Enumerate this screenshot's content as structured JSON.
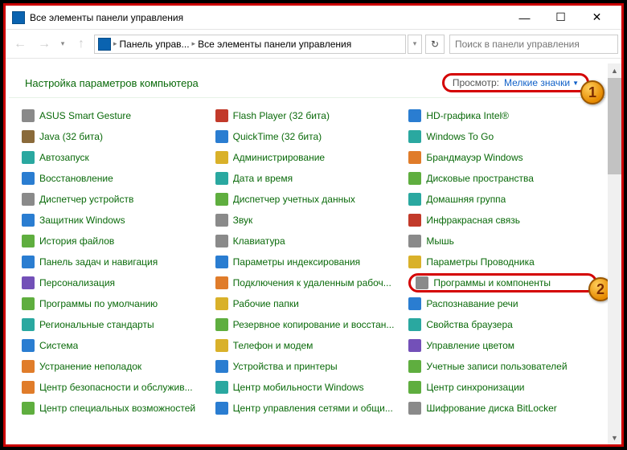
{
  "window": {
    "title": "Все элементы панели управления"
  },
  "breadcrumb": {
    "root": "Панель управ...",
    "current": "Все элементы панели управления"
  },
  "search": {
    "placeholder": "Поиск в панели управления"
  },
  "header": {
    "title": "Настройка параметров компьютера",
    "view_label": "Просмотр:",
    "view_value": "Мелкие значки"
  },
  "items": {
    "col1": [
      {
        "label": "ASUS Smart Gesture",
        "cls": "c-gray"
      },
      {
        "label": "Java (32 бита)",
        "cls": "c-brown"
      },
      {
        "label": "Автозапуск",
        "cls": "c-teal"
      },
      {
        "label": "Восстановление",
        "cls": "c-blue"
      },
      {
        "label": "Диспетчер устройств",
        "cls": "c-gray"
      },
      {
        "label": "Защитник Windows",
        "cls": "c-blue"
      },
      {
        "label": "История файлов",
        "cls": "c-green"
      },
      {
        "label": "Панель задач и навигация",
        "cls": "c-blue"
      },
      {
        "label": "Персонализация",
        "cls": "c-purple"
      },
      {
        "label": "Программы по умолчанию",
        "cls": "c-green"
      },
      {
        "label": "Региональные стандарты",
        "cls": "c-teal"
      },
      {
        "label": "Система",
        "cls": "c-blue"
      },
      {
        "label": "Устранение неполадок",
        "cls": "c-orange"
      },
      {
        "label": "Центр безопасности и обслужив...",
        "cls": "c-orange"
      },
      {
        "label": "Центр специальных возможностей",
        "cls": "c-green"
      }
    ],
    "col2": [
      {
        "label": "Flash Player (32 бита)",
        "cls": "c-red"
      },
      {
        "label": "QuickTime (32 бита)",
        "cls": "c-blue"
      },
      {
        "label": "Администрирование",
        "cls": "c-yellow"
      },
      {
        "label": "Дата и время",
        "cls": "c-teal"
      },
      {
        "label": "Диспетчер учетных данных",
        "cls": "c-green"
      },
      {
        "label": "Звук",
        "cls": "c-gray"
      },
      {
        "label": "Клавиатура",
        "cls": "c-gray"
      },
      {
        "label": "Параметры индексирования",
        "cls": "c-blue"
      },
      {
        "label": "Подключения к удаленным рабоч...",
        "cls": "c-orange"
      },
      {
        "label": "Рабочие папки",
        "cls": "c-yellow"
      },
      {
        "label": "Резервное копирование и восстан...",
        "cls": "c-green"
      },
      {
        "label": "Телефон и модем",
        "cls": "c-yellow"
      },
      {
        "label": "Устройства и принтеры",
        "cls": "c-blue"
      },
      {
        "label": "Центр мобильности Windows",
        "cls": "c-teal"
      },
      {
        "label": "Центр управления сетями и общи...",
        "cls": "c-blue"
      }
    ],
    "col3": [
      {
        "label": "HD-графика Intel®",
        "cls": "c-blue"
      },
      {
        "label": "Windows To Go",
        "cls": "c-teal"
      },
      {
        "label": "Брандмауэр Windows",
        "cls": "c-orange"
      },
      {
        "label": "Дисковые пространства",
        "cls": "c-green"
      },
      {
        "label": "Домашняя группа",
        "cls": "c-teal"
      },
      {
        "label": "Инфракрасная связь",
        "cls": "c-red"
      },
      {
        "label": "Мышь",
        "cls": "c-gray"
      },
      {
        "label": "Параметры Проводника",
        "cls": "c-yellow"
      },
      {
        "label": "Программы и компоненты",
        "cls": "c-gray",
        "highlight": true
      },
      {
        "label": "Распознавание речи",
        "cls": "c-blue"
      },
      {
        "label": "Свойства браузера",
        "cls": "c-teal"
      },
      {
        "label": "Управление цветом",
        "cls": "c-purple"
      },
      {
        "label": "Учетные записи пользователей",
        "cls": "c-green"
      },
      {
        "label": "Центр синхронизации",
        "cls": "c-green"
      },
      {
        "label": "Шифрование диска BitLocker",
        "cls": "c-gray"
      }
    ]
  },
  "badges": {
    "one": "1",
    "two": "2"
  }
}
